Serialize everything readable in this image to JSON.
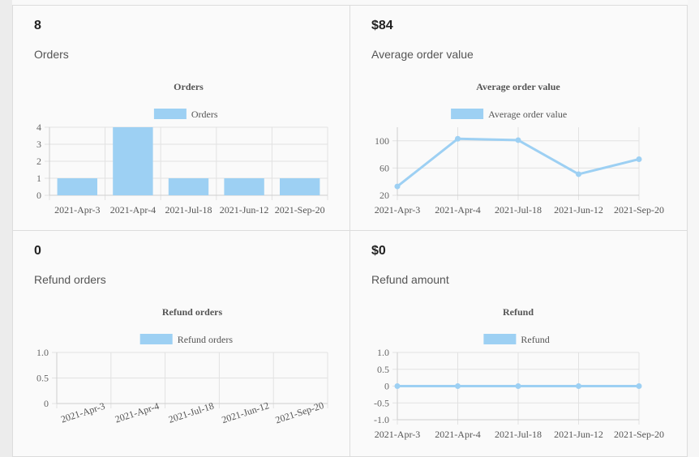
{
  "panels": [
    {
      "metric": "8",
      "label": "Orders",
      "chart_data": {
        "type": "bar",
        "title": "Orders",
        "legend": "Orders",
        "categories": [
          "2021-Apr-3",
          "2021-Apr-4",
          "2021-Jul-18",
          "2021-Jun-12",
          "2021-Sep-20"
        ],
        "values": [
          1,
          4,
          1,
          1,
          1
        ],
        "yticks": [
          "0",
          "1",
          "2",
          "3",
          "4"
        ],
        "ylim": [
          0,
          4
        ],
        "grid": true,
        "color": "#9dd0f3"
      }
    },
    {
      "metric": "$84",
      "label": "Average order value",
      "chart_data": {
        "type": "line",
        "title": "Average order value",
        "legend": "Average order value",
        "categories": [
          "2021-Apr-3",
          "2021-Apr-4",
          "2021-Jul-18",
          "2021-Jun-12",
          "2021-Sep-20"
        ],
        "values": [
          33,
          103,
          101,
          51,
          73
        ],
        "yticks": [
          "20",
          "60",
          "100"
        ],
        "ylim": [
          20,
          120
        ],
        "grid": true,
        "color": "#9dd0f3"
      }
    },
    {
      "metric": "0",
      "label": "Refund orders",
      "chart_data": {
        "type": "bar",
        "title": "Refund orders",
        "legend": "Refund orders",
        "categories": [
          "2021-Apr-3",
          "2021-Apr-4",
          "2021-Jul-18",
          "2021-Jun-12",
          "2021-Sep-20"
        ],
        "values": [
          0,
          0,
          0,
          0,
          0
        ],
        "yticks": [
          "0",
          "0.5",
          "1.0"
        ],
        "ylim": [
          0,
          1
        ],
        "grid": true,
        "color": "#9dd0f3"
      }
    },
    {
      "metric": "$0",
      "label": "Refund amount",
      "chart_data": {
        "type": "line",
        "title": "Refund",
        "legend": "Refund",
        "categories": [
          "2021-Apr-3",
          "2021-Apr-4",
          "2021-Jul-18",
          "2021-Jun-12",
          "2021-Sep-20"
        ],
        "values": [
          0,
          0,
          0,
          0,
          0
        ],
        "yticks": [
          "-1.0",
          "-0.5",
          "0",
          "0.5",
          "1.0"
        ],
        "ylim": [
          -1,
          1
        ],
        "grid": true,
        "color": "#9dd0f3"
      }
    }
  ]
}
